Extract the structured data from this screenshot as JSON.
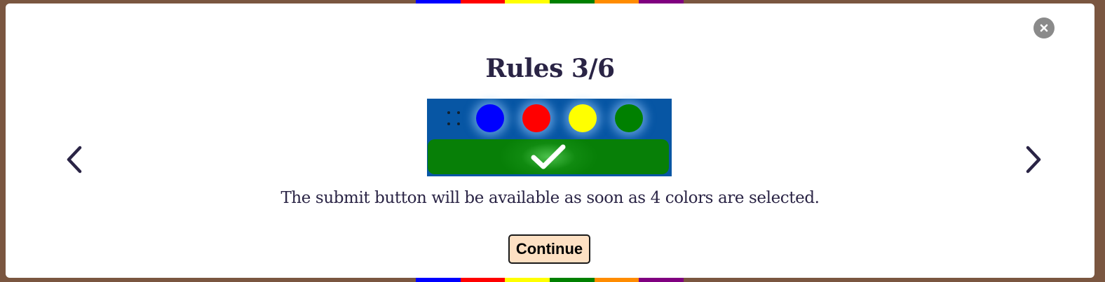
{
  "modal": {
    "title": "Rules 3/6",
    "caption": "The submit button will be available as soon as 4 colors are selected.",
    "continue_label": "Continue"
  },
  "icons": {
    "close": "close-icon",
    "prev": "chevron-left-icon",
    "next": "chevron-right-icon",
    "drag": "drag-handle-icon",
    "check": "checkmark-icon"
  },
  "preview": {
    "pegs": [
      {
        "color": "#0000ff",
        "name": "blue"
      },
      {
        "color": "#ff0000",
        "name": "red"
      },
      {
        "color": "#ffff00",
        "name": "yellow"
      },
      {
        "color": "#008000",
        "name": "green"
      }
    ],
    "background": "#0756a4",
    "submit_color": "#077f07"
  },
  "background_colors": [
    "#0000ff",
    "#ff0000",
    "#ffff00",
    "#008000",
    "#ff8c00",
    "#800080"
  ],
  "colors": {
    "text": "#2a2445",
    "close_bg": "#8a8a8a",
    "continue_bg": "#fde0c3",
    "backdrop": "#7a5640"
  }
}
